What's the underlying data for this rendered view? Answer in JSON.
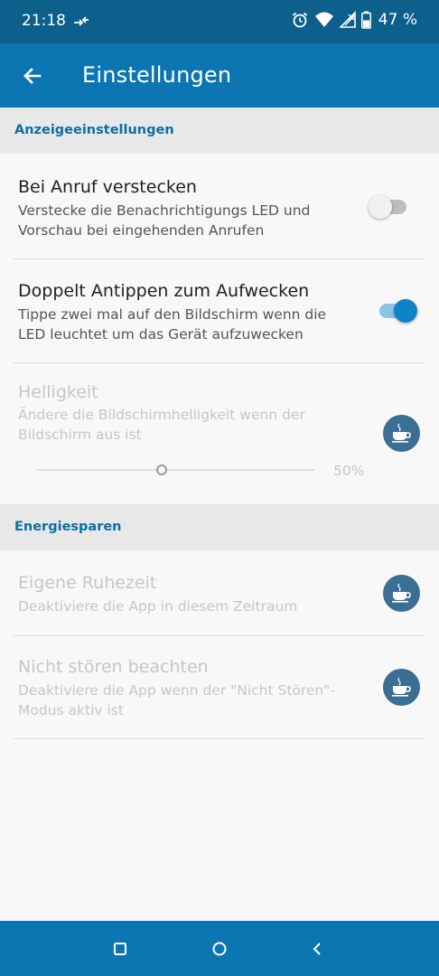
{
  "status_bar": {
    "time": "21:18",
    "battery": "47 %",
    "icons": [
      "data-transfer-icon",
      "alarm-icon",
      "wifi-icon",
      "signal-icon",
      "battery-icon"
    ]
  },
  "app_bar": {
    "title": "Einstellungen",
    "back_icon": "arrow-back-icon",
    "color": "#0c76b2"
  },
  "sections": {
    "display": {
      "header": "Anzeigeeinstellungen",
      "hide_on_call": {
        "title": "Bei Anruf verstecken",
        "summary": "Verstecke die Benachrichtigungs LED und Vorschau bei eingehenden Anrufen",
        "enabled": false
      },
      "double_tap": {
        "title": "Doppelt Antippen zum Aufwecken",
        "summary": "Tippe zwei mal auf den Bildschirm wenn die LED leuchtet um das Gerät aufzuwecken",
        "enabled": true
      },
      "brightness": {
        "title": "Helligkeit",
        "summary": "Ändere die Bildschirmhelligkeit wenn der Bildschirm aus ist",
        "value_label": "50%",
        "value_fraction": 0.45,
        "premium_icon": "coffee-cup-icon"
      }
    },
    "power": {
      "header": "Energiesparen",
      "quiet_time": {
        "title": "Eigene Ruhezeit",
        "summary": "Deaktiviere die App in diesem Zeitraum",
        "premium_icon": "coffee-cup-icon"
      },
      "dnd": {
        "title": "Nicht stören beachten",
        "summary": "Deaktiviere die App wenn der \"Nicht Stören\"-Modus aktiv ist",
        "premium_icon": "coffee-cup-icon"
      }
    }
  },
  "nav_bar": {
    "icons": [
      "recents-square-icon",
      "home-circle-icon",
      "back-chevron-icon"
    ]
  },
  "colors": {
    "status_bar": "#0d5f8c",
    "accent": "#0e84c8",
    "section_header_text": "#0c6fa4",
    "premium_badge": "#3a6f93"
  }
}
